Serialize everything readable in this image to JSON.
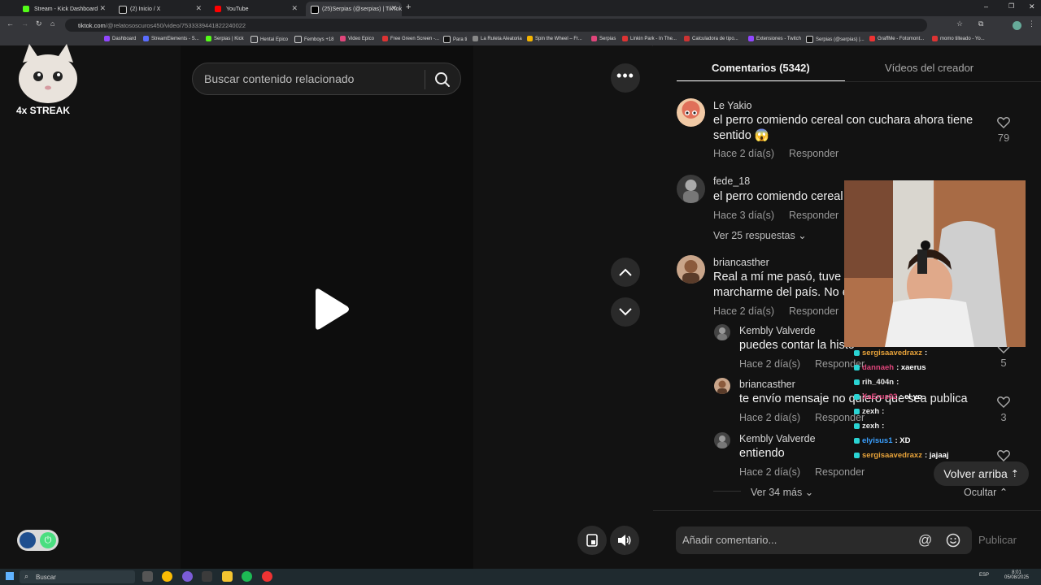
{
  "browser": {
    "tabs": [
      {
        "label": "Stream - Kick Dashboard",
        "favicon_color": "#53fc18"
      },
      {
        "label": "(2) Inicio / X",
        "favicon_color": "#ffffff"
      },
      {
        "label": "YouTube",
        "favicon_color": "#ff0000"
      },
      {
        "label": "(25)Serpias (@serpias) | TikTok",
        "favicon_color": "#ffffff"
      }
    ],
    "url_host": "tiktok.com",
    "url_path": "/@relatososcuros450/video/7533339441822240022",
    "bookmarks": [
      "Dashboard",
      "StreamElements - S...",
      "Serpias | Kick",
      "Hentai Epico",
      "Femboys +18",
      "Video Epico",
      "Free Green Screen -...",
      "Para ti",
      "La Ruleta Aleatoria",
      "Spin the Wheel – Fr...",
      "Serpias",
      "Linkin Park - In The...",
      "Calculadora de tipo...",
      "Extensiones - Twitch",
      "Serpias (@serpias) |...",
      "GraffMe - Fotomont...",
      "momo tilteado - Yo..."
    ]
  },
  "overlay": {
    "streak_label": "4x STREAK"
  },
  "search": {
    "placeholder": "Buscar contenido relacionado"
  },
  "comments_panel": {
    "tab_comments": "Comentarios (5342)",
    "tab_creator": "Vídeos del creador",
    "reply_label": "Responder",
    "comments": [
      {
        "user": "Le Yakio",
        "text_line1": "el perro comiendo cereal con cuchara ahora tiene",
        "text_line2": "sentido 😱",
        "age": "Hace 2 día(s)",
        "likes": "79"
      },
      {
        "user": "fede_18",
        "text_line1": "el perro comiendo cereal",
        "age": "Hace 3 día(s)",
        "replies_toggle": "Ver 25 respuestas"
      },
      {
        "user": "briancasther",
        "text_line1": "Real a mí me pasó, tuve c",
        "text_line2": "marcharme del país. No e",
        "age": "Hace 2 día(s)"
      }
    ],
    "replies": [
      {
        "user": "Kembly Valverde",
        "text": "puedes contar la histo",
        "age": "Hace 2 día(s)",
        "likes": "5"
      },
      {
        "user": "briancasther",
        "text": "te envío mensaje no quiero que sea publica",
        "age": "Hace 2 día(s)",
        "likes": "3"
      },
      {
        "user": "Kembly Valverde",
        "text": "entiendo",
        "age": "Hace 2 día(s)"
      }
    ],
    "see_more": "Ver 34 más",
    "hide": "Ocultar",
    "back_to_top": "Volver arriba",
    "composer_placeholder": "Añadir comentario...",
    "publish": "Publicar"
  },
  "chat": [
    {
      "user": "sergisaavedraxz",
      "msg": ":",
      "color": "#e8a33a"
    },
    {
      "user": "dannaeh",
      "msg": ": xaerus",
      "color": "#e0457b"
    },
    {
      "user": "rih_404n",
      "msg": ":",
      "color": "#e8e8e8"
    },
    {
      "user": "XaErus02",
      "msg": ": el yo",
      "color": "#e0457b"
    },
    {
      "user": "zexh",
      "msg": ":",
      "color": "#e8e8e8"
    },
    {
      "user": "zexh",
      "msg": ":",
      "color": "#e8e8e8"
    },
    {
      "user": "elyisus1",
      "msg": ": XD",
      "color": "#3aa0ff"
    },
    {
      "user": "sergisaavedraxz",
      "msg": ": jajaaj",
      "color": "#e8a33a"
    }
  ],
  "taskbar": {
    "search_label": "Buscar",
    "language": "ESP",
    "time": "8:01",
    "date": "05/08/2025"
  },
  "colors": {
    "accent": "#fe2c55",
    "background": "#121212"
  }
}
